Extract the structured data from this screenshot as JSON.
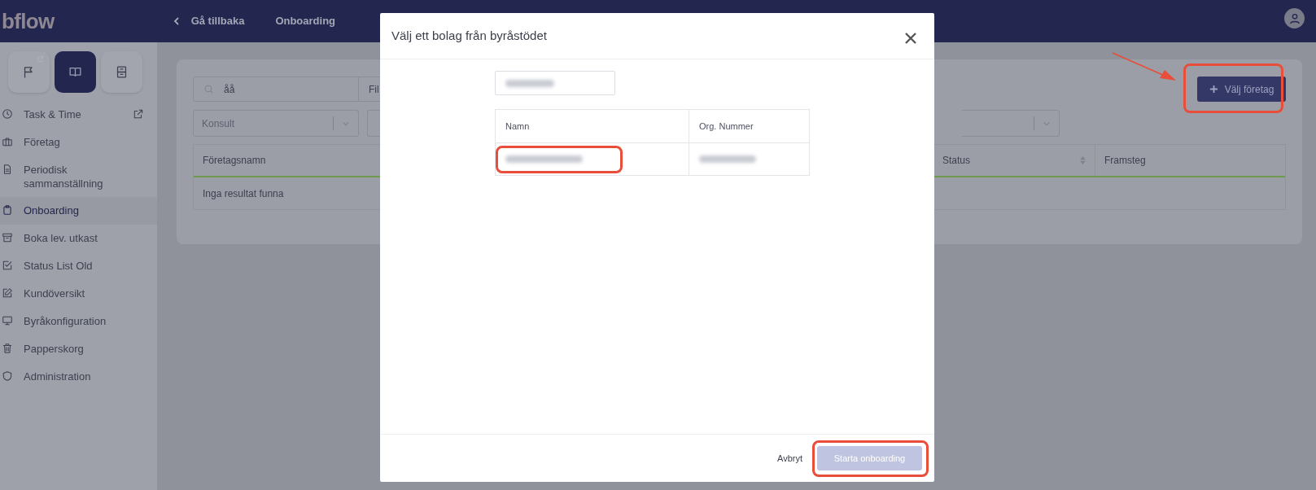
{
  "header": {
    "logo": "bflow",
    "back": "Gå tillbaka",
    "title": "Onboarding"
  },
  "sidebar": {
    "tiles": [
      {
        "kind": "flag",
        "selected": false,
        "external": true
      },
      {
        "kind": "book",
        "selected": true,
        "external": false
      },
      {
        "kind": "cabinet",
        "selected": false,
        "external": false
      }
    ],
    "items": [
      {
        "kind": "clock",
        "label": "Task & Time",
        "selected": false,
        "external": true
      },
      {
        "kind": "briefcase",
        "label": "Företag",
        "selected": false,
        "external": false
      },
      {
        "kind": "doc",
        "label": "Periodisk sammanställning",
        "selected": false,
        "external": false
      },
      {
        "kind": "clipboard",
        "label": "Onboarding",
        "selected": true,
        "external": false
      },
      {
        "kind": "archive",
        "label": "Boka lev. utkast",
        "selected": false,
        "external": false
      },
      {
        "kind": "check",
        "label": "Status List Old",
        "selected": false,
        "external": false
      },
      {
        "kind": "edit",
        "label": "Kundöversikt",
        "selected": false,
        "external": false
      },
      {
        "kind": "monitor",
        "label": "Byråkonfiguration",
        "selected": false,
        "external": false
      },
      {
        "kind": "trash",
        "label": "Papperskorg",
        "selected": false,
        "external": false
      },
      {
        "kind": "shield",
        "label": "Administration",
        "selected": false,
        "external": false
      }
    ]
  },
  "main": {
    "search": {
      "value": "åå"
    },
    "filter_text": "Fil",
    "consultant_select": {
      "placeholder": "Konsult"
    },
    "add_button": {
      "label": "Välj företag",
      "annotated": true,
      "pointer_arrow": true
    },
    "table": {
      "columns": [
        {
          "label": "Företagsnamn",
          "sortable": false
        },
        {
          "label": "Status",
          "sortable": true
        },
        {
          "label": "Framsteg",
          "sortable": false
        }
      ],
      "empty_text": "Inga resultat funna"
    }
  },
  "modal": {
    "title": "Välj ett bolag från byråstödet",
    "search_field": {
      "blurred": true
    },
    "table": {
      "columns": [
        "Namn",
        "Org. Nummer"
      ],
      "rows": [
        {
          "cells": [
            {
              "blurred": true,
              "annotated": true
            },
            {
              "blurred": true,
              "annotated": false
            }
          ]
        }
      ]
    },
    "cancel": "Avbryt",
    "confirm": {
      "label": "Starta onboarding",
      "disabled": true,
      "annotated": true
    }
  }
}
